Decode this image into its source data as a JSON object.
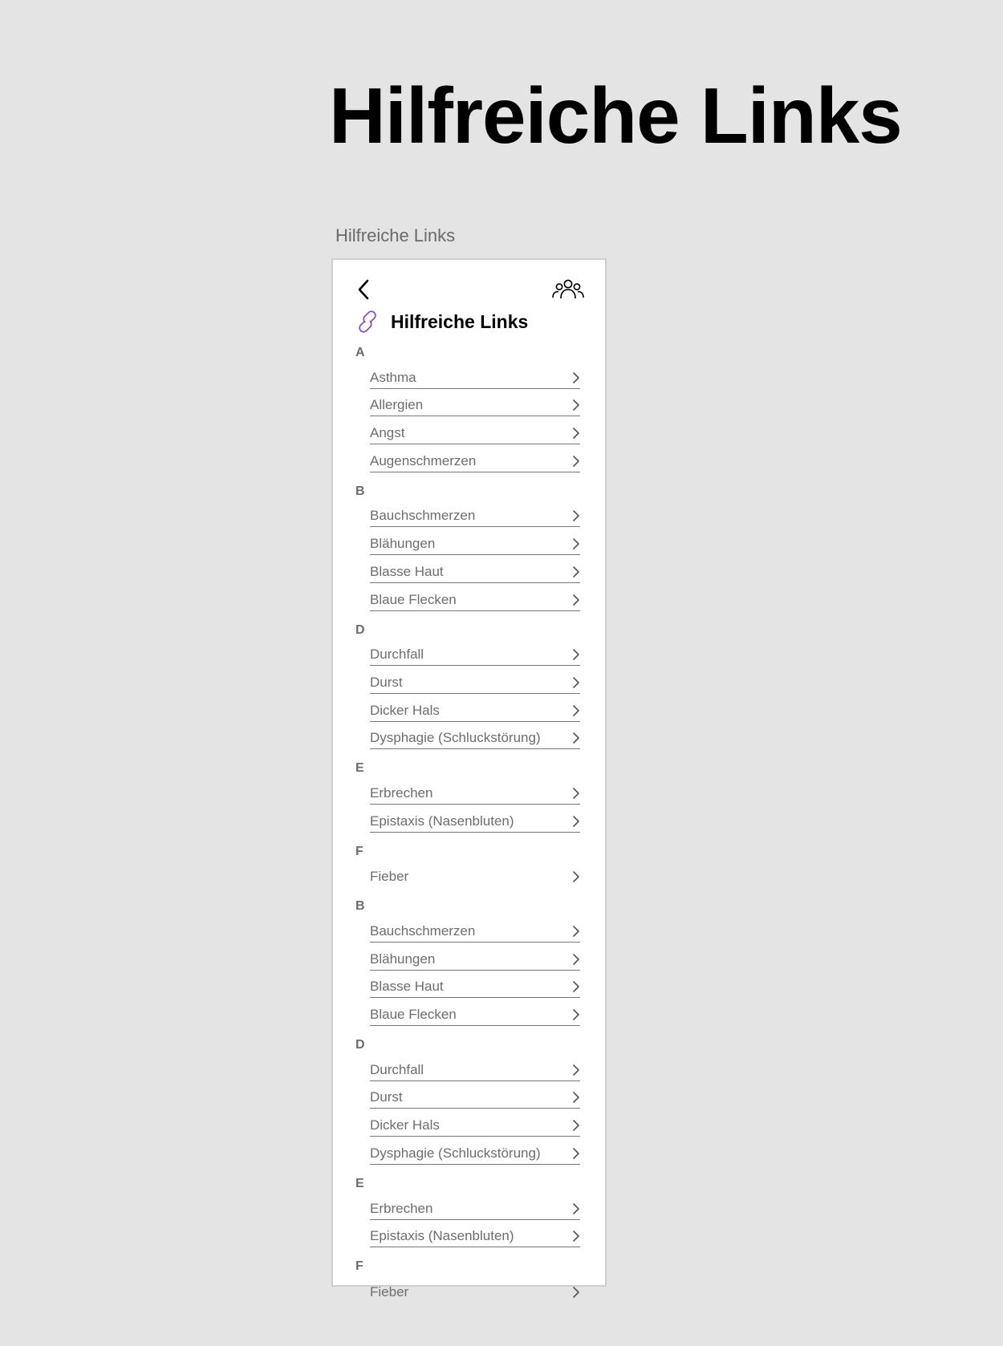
{
  "page": {
    "heading": "Hilfreiche Links",
    "frame_label": "Hilfreiche Links"
  },
  "screen": {
    "back_icon": "chevron-left-icon",
    "community_icon": "people-group-icon",
    "title_icon": "link-chain-icon",
    "title": "Hilfreiche Links",
    "colors": {
      "accent": "#8e4ec6",
      "text": "#6d6d6d",
      "divider": "#777777"
    },
    "sections": [
      {
        "letter": "A",
        "items": [
          {
            "label": "Asthma"
          },
          {
            "label": "Allergien"
          },
          {
            "label": "Angst"
          },
          {
            "label": "Augenschmerzen"
          }
        ]
      },
      {
        "letter": "B",
        "items": [
          {
            "label": "Bauchschmerzen"
          },
          {
            "label": "Blähungen"
          },
          {
            "label": "Blasse Haut"
          },
          {
            "label": "Blaue Flecken"
          }
        ]
      },
      {
        "letter": "D",
        "items": [
          {
            "label": "Durchfall"
          },
          {
            "label": "Durst"
          },
          {
            "label": "Dicker Hals"
          },
          {
            "label": "Dysphagie (Schluckstörung)"
          }
        ]
      },
      {
        "letter": "E",
        "items": [
          {
            "label": "Erbrechen"
          },
          {
            "label": "Epistaxis (Nasenbluten)"
          }
        ]
      },
      {
        "letter": "F",
        "items": [
          {
            "label": "Fieber",
            "divider": false
          }
        ]
      },
      {
        "letter": "B",
        "items": [
          {
            "label": "Bauchschmerzen"
          },
          {
            "label": "Blähungen"
          },
          {
            "label": "Blasse Haut"
          },
          {
            "label": "Blaue Flecken"
          }
        ]
      },
      {
        "letter": "D",
        "items": [
          {
            "label": "Durchfall"
          },
          {
            "label": "Durst"
          },
          {
            "label": "Dicker Hals"
          },
          {
            "label": "Dysphagie (Schluckstörung)"
          }
        ]
      },
      {
        "letter": "E",
        "items": [
          {
            "label": "Erbrechen"
          },
          {
            "label": "Epistaxis (Nasenbluten)"
          }
        ]
      },
      {
        "letter": "F",
        "items": [
          {
            "label": "Fieber",
            "divider": false
          }
        ]
      }
    ]
  }
}
